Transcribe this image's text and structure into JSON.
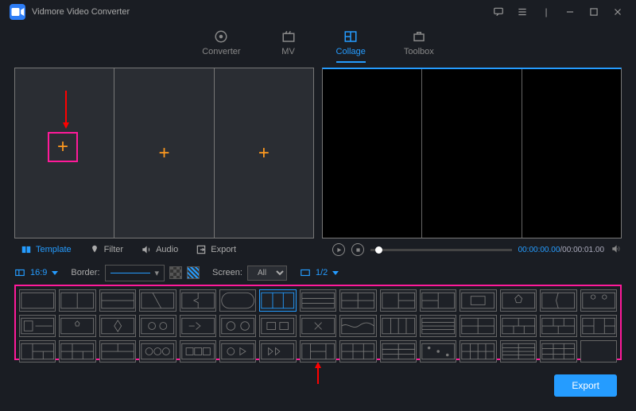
{
  "app": {
    "title": "Vidmore Video Converter"
  },
  "nav": {
    "converter": "Converter",
    "mv": "MV",
    "collage": "Collage",
    "toolbox": "Toolbox"
  },
  "tabs": {
    "template": "Template",
    "filter": "Filter",
    "audio": "Audio",
    "export": "Export"
  },
  "toolbar": {
    "ratio": "16:9",
    "border_label": "Border:",
    "screen_label": "Screen:",
    "screen_value": "All",
    "zoom": "1/2"
  },
  "playback": {
    "current": "00:00:00.00",
    "sep": "/",
    "total": "00:00:01.00"
  },
  "buttons": {
    "export": "Export"
  }
}
